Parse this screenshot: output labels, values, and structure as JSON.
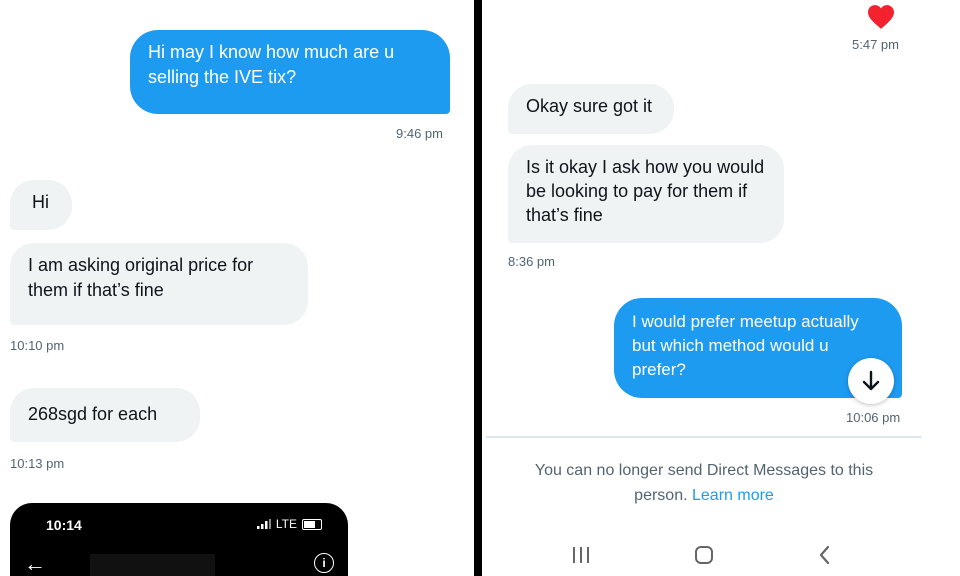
{
  "left": {
    "messages": [
      {
        "text": "Hi may I know how much are u\nselling the IVE tix?",
        "time": "9:46 pm"
      },
      {
        "text": "Hi"
      },
      {
        "text": "I am asking original price for\nthem if that’s fine",
        "time": "10:10 pm"
      },
      {
        "text": "268sgd for each",
        "time": "10:13 pm"
      }
    ],
    "phone": {
      "time": "10:14",
      "network": "LTE"
    }
  },
  "right": {
    "top_time": "5:47 pm",
    "messages": [
      {
        "text": "Okay sure got it"
      },
      {
        "text": "Is it okay I ask how you would\nbe looking to pay for them if\nthat’s fine",
        "time": "8:36 pm"
      },
      {
        "text": "I would prefer meetup actually\nbut which method would u\nprefer?",
        "time": "10:06 pm"
      }
    ],
    "notice": "You can no longer send Direct Messages to this person.",
    "learn_more": "Learn more"
  },
  "colors": {
    "sent": "#1d9bf0",
    "received": "#eff3f4",
    "link": "#1d9bf0",
    "heart": "#f4212e"
  },
  "icons": [
    "heart-icon",
    "arrow-down-icon",
    "back-arrow-icon",
    "info-icon",
    "recent-apps-icon",
    "home-icon",
    "back-icon"
  ]
}
